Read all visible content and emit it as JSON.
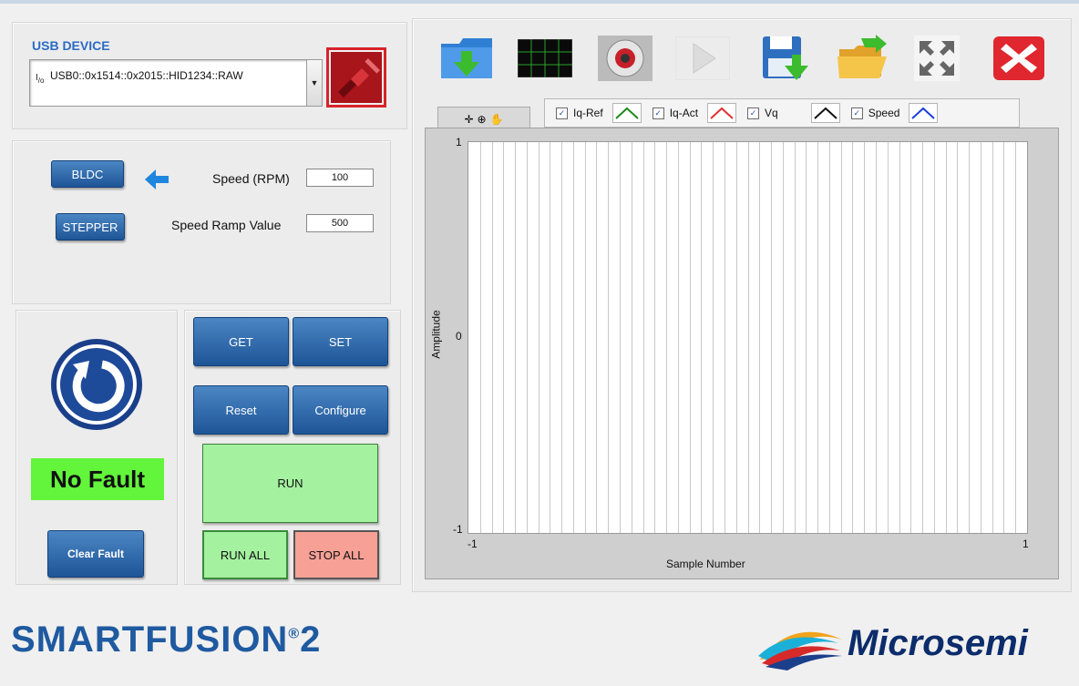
{
  "usb": {
    "title": "USB DEVICE",
    "io_glyph": "I/O",
    "device": "USB0::0x1514::0x2015::HID1234::RAW"
  },
  "motor": {
    "bldc_label": "BLDC",
    "stepper_label": "STEPPER",
    "speed_label": "Speed (RPM)",
    "speed_value": "100",
    "ramp_label": "Speed Ramp Value",
    "ramp_value": "500"
  },
  "actions": {
    "get": "GET",
    "set": "SET",
    "reset": "Reset",
    "configure": "Configure",
    "run": "RUN",
    "run_all": "RUN ALL",
    "stop_all": "STOP ALL"
  },
  "status": {
    "fault_text": "No Fault",
    "clear_fault": "Clear Fault"
  },
  "legend": [
    {
      "name": "Iq-Ref",
      "color": "#1a8a1a"
    },
    {
      "name": "Iq-Act",
      "color": "#e03030"
    },
    {
      "name": "Vq",
      "color": "#111111"
    },
    {
      "name": "Speed",
      "color": "#1a3ee0"
    }
  ],
  "chart_data": {
    "type": "line",
    "title": "",
    "xlabel": "Sample Number",
    "ylabel": "Amplitude",
    "xlim": [
      -1,
      1
    ],
    "ylim": [
      -1,
      1
    ],
    "y_ticks": [
      "1",
      "0",
      "-1"
    ],
    "x_ticks": [
      "-1",
      "1"
    ],
    "series": [],
    "grid": "vertical"
  },
  "branding": {
    "left": "SMARTFUSION",
    "left_suffix": "2",
    "right": "Microsemi"
  },
  "colors": {
    "accent_blue": "#1e5597",
    "fault_green": "#62f53b",
    "run_green": "#a4f1a0",
    "stop_red": "#f6a096"
  }
}
